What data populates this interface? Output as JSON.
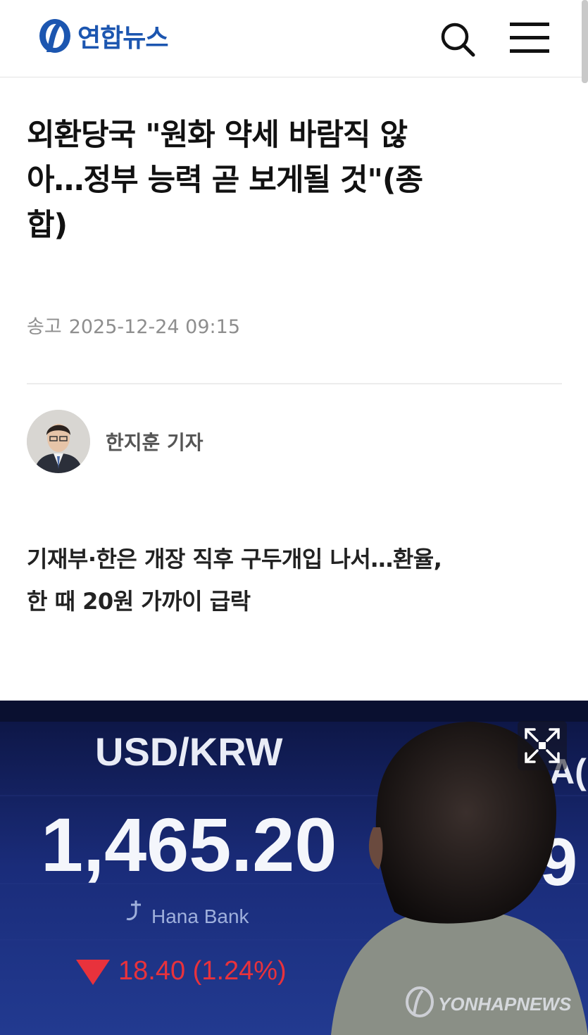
{
  "header": {
    "logo_text": "연합뉴스",
    "search_icon": "search-icon",
    "menu_icon": "hamburger-menu-icon",
    "brand_color": "#1c56b0"
  },
  "article": {
    "title_lines": [
      "외환당국 \"원화 약세 바람직 않",
      "아…정부 능력 곧 보게될 것\"(종",
      "합)"
    ],
    "sent_label": "송고",
    "sent_datetime": "2025-12-24 09:15",
    "author": "한지훈 기자",
    "subtitle_lines": [
      "기재부·한은 개장 직후 구두개입 나서…환율,",
      "한 때 20원 가까이 급락"
    ]
  },
  "photo": {
    "board_label": "USD/KRW",
    "rate_value": "1,465.20",
    "bank_name": "Hana Bank",
    "change_text": "18.40 (1.24%)",
    "side_partial_top": "A(",
    "side_partial_value": ".9",
    "watermark": "YONHAPNEWS",
    "expand_icon": "fullscreen-expand-icon",
    "down_color": "#e8323c"
  }
}
